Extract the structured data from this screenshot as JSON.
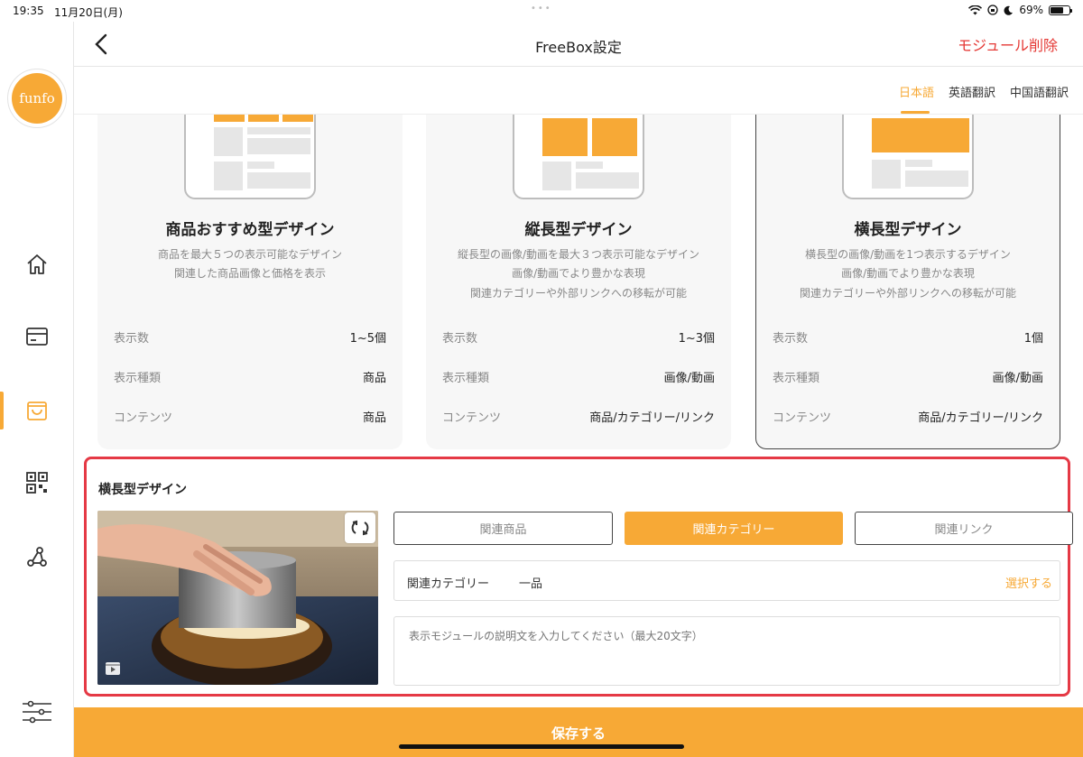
{
  "status_bar": {
    "time": "19:35",
    "date": "11月20日(月)",
    "battery_text": "69%",
    "battery_level": 0.69
  },
  "brand": {
    "logo_text": "funfo",
    "accent": "#f7a936",
    "danger": "#e53935"
  },
  "sidebar": {
    "icons": [
      "home-icon",
      "card-icon",
      "shop-icon",
      "qr-code-icon",
      "network-icon",
      "settings-sliders-icon"
    ],
    "active_index": 2
  },
  "header": {
    "title": "FreeBox設定",
    "delete_label": "モジュール削除"
  },
  "languages": [
    {
      "label": "日本語",
      "active": true
    },
    {
      "label": "英語翻訳",
      "active": false
    },
    {
      "label": "中国語翻訳",
      "active": false
    }
  ],
  "cards": [
    {
      "title": "商品おすすめ型デザイン",
      "desc": [
        "商品を最大５つの表示可能なデザイン",
        "関連した商品画像と価格を表示"
      ],
      "specs": [
        {
          "key": "表示数",
          "value": "1~5個"
        },
        {
          "key": "表示種類",
          "value": "商品"
        },
        {
          "key": "コンテンツ",
          "value": "商品"
        }
      ],
      "selected": false
    },
    {
      "title": "縦長型デザイン",
      "desc": [
        "縦長型の画像/動画を最大３つ表示可能なデザイン",
        "画像/動画でより豊かな表現",
        "関連カテゴリーや外部リンクへの移転が可能"
      ],
      "specs": [
        {
          "key": "表示数",
          "value": "1~3個"
        },
        {
          "key": "表示種類",
          "value": "画像/動画"
        },
        {
          "key": "コンテンツ",
          "value": "商品/カテゴリー/リンク"
        }
      ],
      "selected": false
    },
    {
      "title": "横長型デザイン",
      "desc": [
        "横長型の画像/動画を1つ表示するデザイン",
        "画像/動画でより豊かな表現",
        "関連カテゴリーや外部リンクへの移転が可能"
      ],
      "specs": [
        {
          "key": "表示数",
          "value": "1個"
        },
        {
          "key": "表示種類",
          "value": "画像/動画"
        },
        {
          "key": "コンテンツ",
          "value": "商品/カテゴリー/リンク"
        }
      ],
      "selected": true
    }
  ],
  "editor": {
    "title": "横長型デザイン",
    "tabs": [
      {
        "label": "関連商品",
        "active": false
      },
      {
        "label": "関連カテゴリー",
        "active": true
      },
      {
        "label": "関連リンク",
        "active": false
      }
    ],
    "field": {
      "label": "関連カテゴリー",
      "value": "一品",
      "action": "選択する"
    },
    "description_placeholder": "表示モジュールの説明文を入力してください（最大20文字）"
  },
  "save_label": "保存する"
}
